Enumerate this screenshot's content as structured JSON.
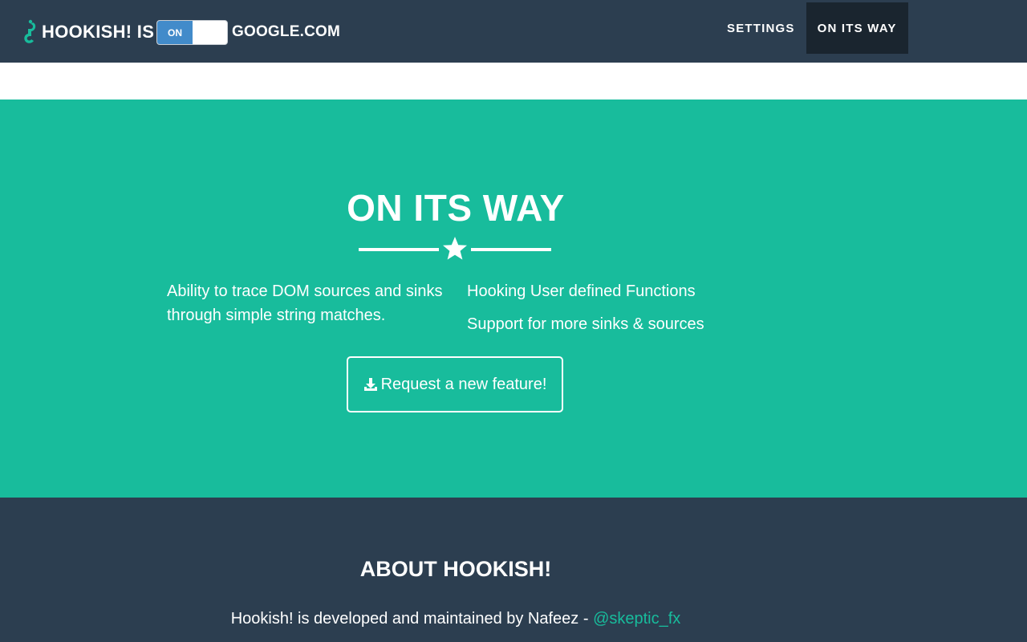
{
  "header": {
    "brand_icon": "hook-icon",
    "brand_prefix": "HOOKISH! IS",
    "toggle": {
      "state_label": "ON"
    },
    "domain": "GOOGLE.COM",
    "nav": [
      {
        "label": "SETTINGS",
        "active": false
      },
      {
        "label": "ON ITS WAY",
        "active": true
      }
    ]
  },
  "hero": {
    "title": "ON ITS WAY",
    "divider_icon": "star-icon",
    "features_left": [
      "Ability to trace DOM sources and sinks through simple string matches."
    ],
    "features_right": [
      "Hooking User defined Functions",
      "Support for more sinks & sources"
    ],
    "button": {
      "icon": "download-icon",
      "label": "Request a new feature!"
    }
  },
  "footer": {
    "title": "ABOUT HOOKISH!",
    "text_prefix": "Hookish! is developed and maintained by Nafeez - ",
    "link_text": "@skeptic_fx"
  },
  "colors": {
    "navbar": "#2c3e50",
    "nav_active": "#1a252f",
    "hero": "#18bc9c",
    "toggle_on": "#428bca",
    "link": "#18bc9c"
  }
}
